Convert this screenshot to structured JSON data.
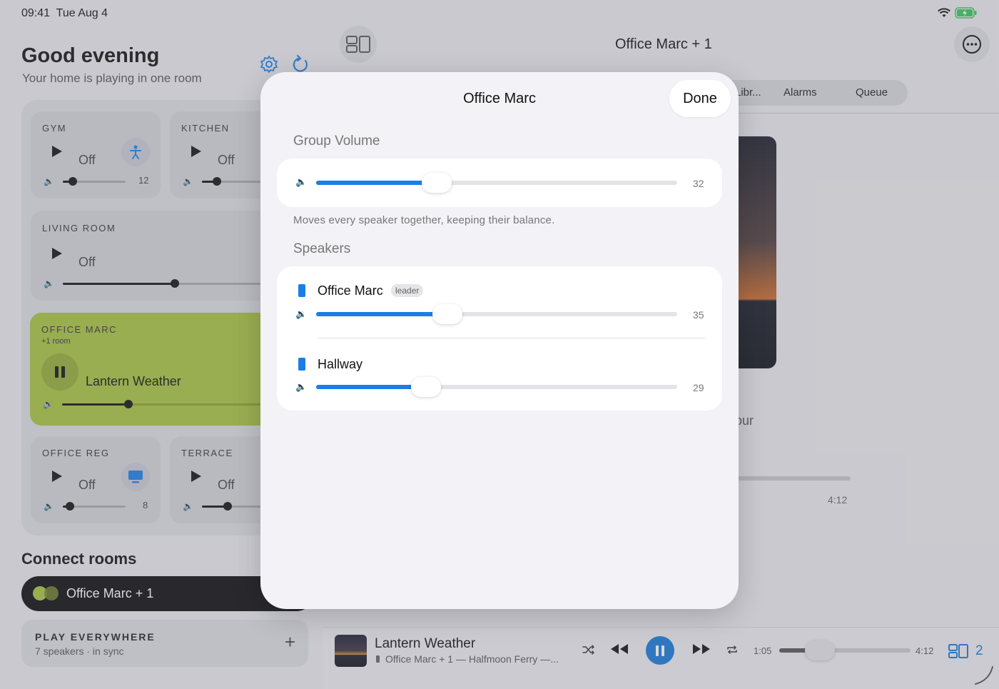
{
  "status": {
    "time": "09:41",
    "date": "Tue Aug 4"
  },
  "home": {
    "title": "Good evening",
    "subtitle": "Your home is playing in one room"
  },
  "rooms": [
    {
      "name": "GYM",
      "state": "Off",
      "volume": "12",
      "icon": "person-icon"
    },
    {
      "name": "KITCHEN",
      "state": "Off"
    },
    {
      "name": "LIVING ROOM",
      "state": "Off"
    },
    {
      "name": "OFFICE MARC",
      "sub": "+1 room",
      "state": "Lantern Weather"
    },
    {
      "name": "OFFICE REG",
      "state": "Off",
      "volume": "8",
      "icon": "monitor-icon"
    },
    {
      "name": "TERRACE",
      "state": "Off"
    }
  ],
  "connect": {
    "title": "Connect rooms",
    "group_label": "Office Marc + 1"
  },
  "everywhere": {
    "title": "PLAY EVERYWHERE",
    "subtitle": "7 speakers · in sync"
  },
  "now_playing": {
    "header_title": "Office Marc + 1",
    "tabs": [
      "Libr...",
      "Alarms",
      "Queue"
    ],
    "partial_text": "our",
    "duration": "4:12"
  },
  "mini_player": {
    "track": "Lantern Weather",
    "subtitle": "Office Marc + 1 — Halfmoon Ferry —...",
    "elapsed": "1:05",
    "duration": "4:12",
    "group_count": "2",
    "progress": 0.26
  },
  "sheet": {
    "title": "Office Marc",
    "done_label": "Done",
    "group_volume_heading": "Group Volume",
    "group_volume": 32,
    "group_volume_text": "32",
    "footnote": "Moves every speaker together, keeping their balance.",
    "speakers_heading": "Speakers",
    "speakers": [
      {
        "name": "Office Marc",
        "tag": "leader",
        "volume": 35,
        "volume_text": "35"
      },
      {
        "name": "Hallway",
        "volume": 29,
        "volume_text": "29"
      }
    ]
  },
  "colors": {
    "accent": "#1a7ee6",
    "active_room": "#a7c23f",
    "battery": "#34c759"
  }
}
